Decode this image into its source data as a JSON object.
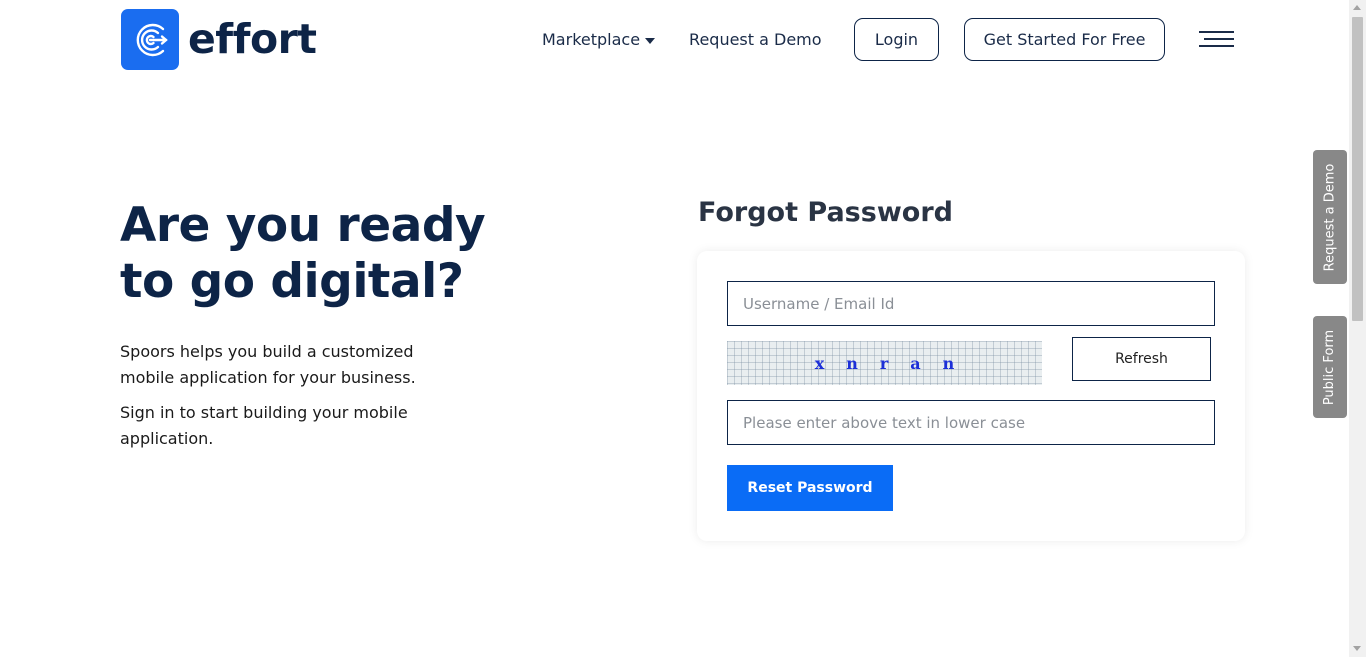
{
  "header": {
    "logo_text": "effort",
    "logo_icon": "effort-logo-icon",
    "nav": {
      "marketplace": "Marketplace",
      "request_demo": "Request a Demo"
    },
    "login_label": "Login",
    "get_started_label": "Get Started For Free",
    "menu_icon": "hamburger-menu-icon"
  },
  "hero": {
    "title_line1": "Are you ready",
    "title_line2": "to go digital?",
    "paragraph1": "Spoors helps you build a customized mobile application for your business.",
    "paragraph2": "Sign in to start building your mobile application."
  },
  "forgot_password": {
    "title": "Forgot Password",
    "username_placeholder": "Username / Email Id",
    "captcha_text": "xnran",
    "refresh_label": "Refresh",
    "captcha_placeholder": "Please enter above text in lower case",
    "reset_label": "Reset Password"
  },
  "side_tabs": {
    "request_demo": "Request a Demo",
    "public_form": "Public Form"
  },
  "colors": {
    "brand_navy": "#0d2447",
    "primary_blue": "#0a6cf6",
    "logo_blue": "#1a6df0",
    "side_tab_gray": "#888888"
  }
}
